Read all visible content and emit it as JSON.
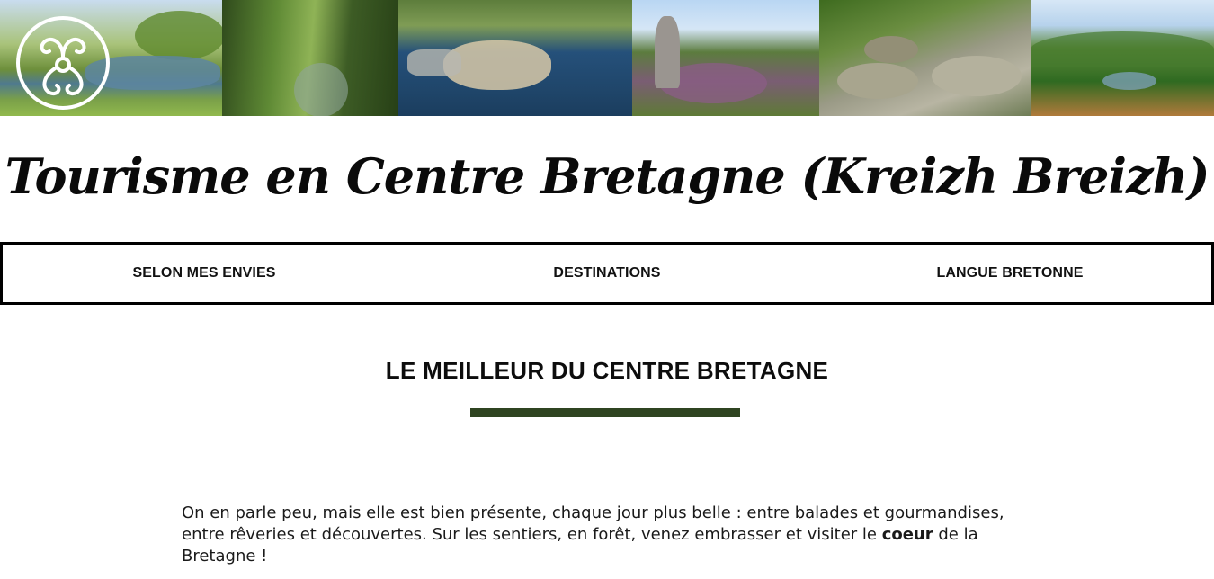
{
  "banner": {
    "photos": [
      {
        "name": "lake-castle-photo"
      },
      {
        "name": "forest-stream-photo"
      },
      {
        "name": "lake-aerial-photo"
      },
      {
        "name": "rock-heather-photo"
      },
      {
        "name": "granite-boulders-photo"
      },
      {
        "name": "river-valley-photo"
      }
    ],
    "logo_icon": "triskelion-icon"
  },
  "site": {
    "title": "Tourisme en Centre Bretagne (Kreizh Breizh)"
  },
  "nav": {
    "items": [
      {
        "label": "SELON MES ENVIES"
      },
      {
        "label": "DESTINATIONS"
      },
      {
        "label": "LANGUE BRETONNE"
      }
    ]
  },
  "main": {
    "heading": "LE MEILLEUR DU CENTRE BRETAGNE",
    "intro_before": "On en parle peu, mais elle est bien présente, chaque jour plus belle : entre balades et gourmandises, entre rêveries et découvertes. Sur les sentiers, en forêt, venez embrasser et visiter le ",
    "intro_bold": "coeur",
    "intro_after": " de la Bretagne !"
  },
  "colors": {
    "accent_bar": "#2f4421",
    "nav_border": "#000000"
  }
}
